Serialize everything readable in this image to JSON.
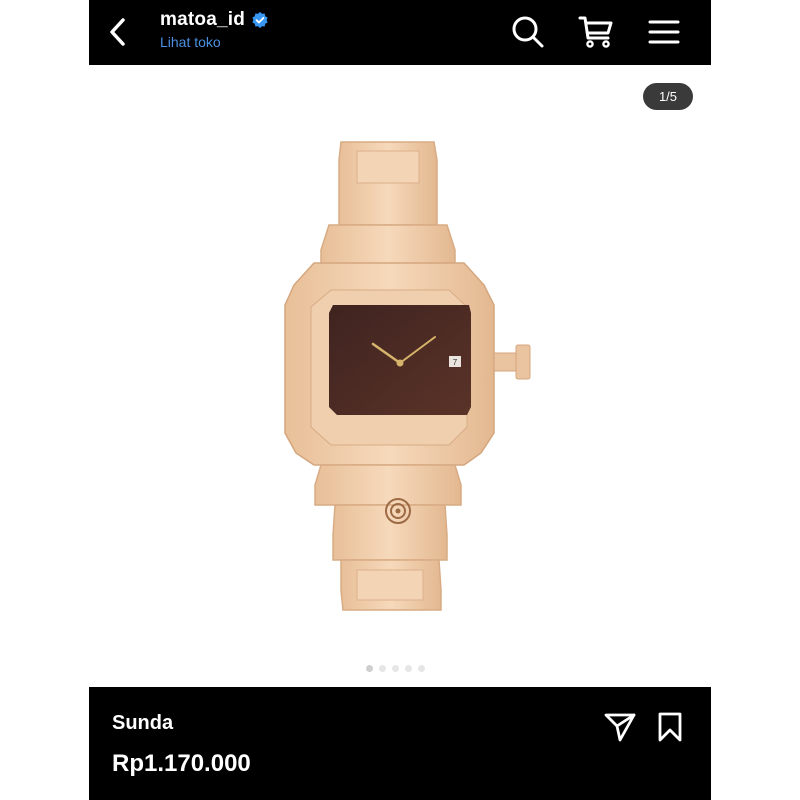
{
  "header": {
    "shop_name": "matoa_id",
    "shop_link": "Lihat toko",
    "icons": {
      "back": "back-chevron-icon",
      "verified": "verified-badge-icon",
      "search": "search-icon",
      "cart": "cart-icon",
      "menu": "menu-icon"
    }
  },
  "gallery": {
    "counter": "1/5",
    "image_alt": "Wooden watch with maple wood strap and dark wood dial",
    "dot_count": 5,
    "active_index": 0
  },
  "product": {
    "name": "Sunda",
    "price": "Rp1.170.000",
    "icons": {
      "share": "share-send-icon",
      "bookmark": "bookmark-icon"
    }
  },
  "colors": {
    "bar_bg": "#000000",
    "link_blue": "#4a90e2",
    "verified_blue": "#3897f0",
    "wood_light": "#efcba6",
    "dial_dark": "#4a2a24"
  }
}
